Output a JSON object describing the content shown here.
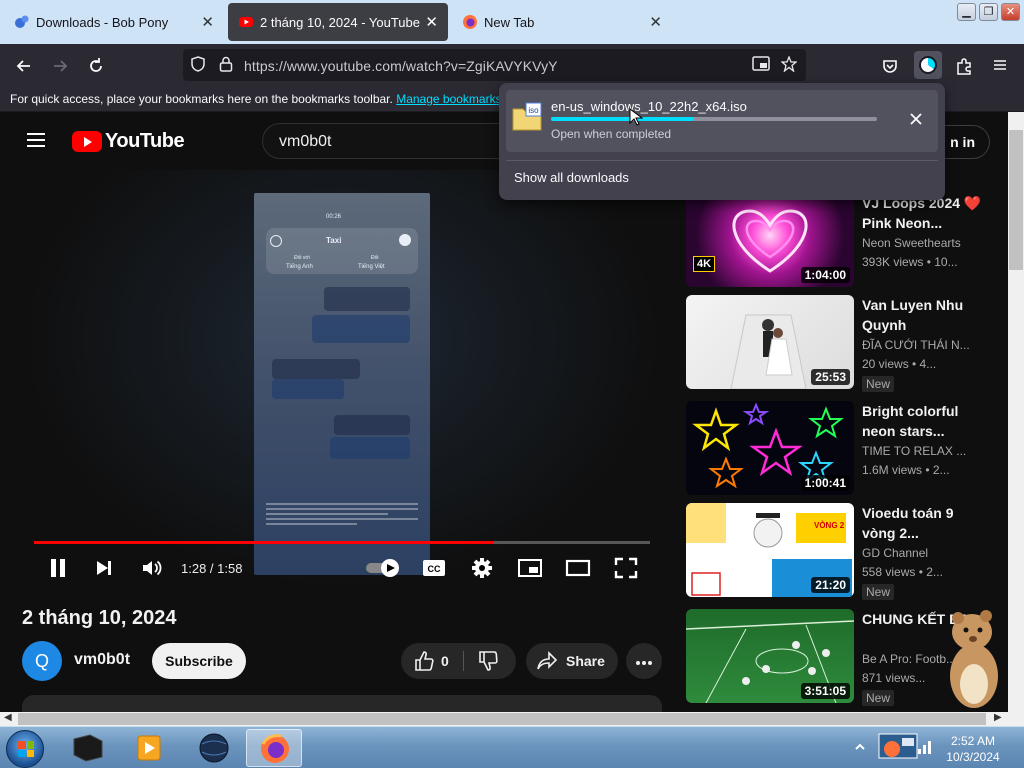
{
  "browser": {
    "tabs": [
      {
        "title": "Downloads - Bob Pony",
        "active": false
      },
      {
        "title": "2 tháng 10, 2024 - YouTube",
        "active": true
      },
      {
        "title": "New Tab",
        "active": false
      }
    ],
    "url": "https://www.youtube.com/watch?v=ZgiKAVYKVyY",
    "bookmarks_hint": "For quick access, place your bookmarks here on the bookmarks toolbar.",
    "bookmarks_link": "Manage bookmarks..."
  },
  "downloads_panel": {
    "file_name": "en-us_windows_10_22h2_x64.iso",
    "file_type_label": "iso",
    "status": "Open when completed",
    "progress": 0.44,
    "show_all": "Show all downloads"
  },
  "youtube": {
    "logo_text": "YouTube",
    "search_value": "vm0b0t",
    "sign_in_label": "n in",
    "player": {
      "time": "1:28 / 1:58",
      "progress": 0.746
    },
    "video_title": "2 tháng 10, 2024",
    "channel": {
      "name": "vm0b0t",
      "avatar_letter": "Q"
    },
    "subscribe_label": "Subscribe",
    "like_count": "0",
    "share_label": "Share",
    "phone_screen": {
      "time": "00:26",
      "header": "Taxi",
      "from_label": "Đối với",
      "from_lang": "Tiếng Anh",
      "to_label": "Đối",
      "to_lang": "Tiếng Việt"
    },
    "recommendations": [
      {
        "title": "VJ Loops 2024 ❤️ Pink Neon...",
        "channel": "Neon Sweethearts",
        "meta": "393K views • 10...",
        "duration": "1:04:00",
        "badge": "",
        "thumb_badge": "4K"
      },
      {
        "title": "Van Luyen Nhu Quynh",
        "channel": "ĐĨA CƯỚI THÁI N...",
        "meta": "20 views • 4...",
        "duration": "25:53",
        "badge": "New",
        "thumb_badge": ""
      },
      {
        "title": "Bright colorful neon stars...",
        "channel": "TIME TO RELAX ...",
        "meta": "1.6M views • 2...",
        "duration": "1:00:41",
        "badge": "",
        "thumb_badge": ""
      },
      {
        "title": "Vioedu toán 9 vòng 2...",
        "channel": "GD Channel",
        "meta": "558 views • 2...",
        "duration": "21:20",
        "badge": "New",
        "thumb_badge": "VÒNG 2"
      },
      {
        "title": "CHUNG KẾT BAP...",
        "channel": "Be A Pro: Footb...",
        "meta": "871 views...",
        "duration": "3:51:05",
        "badge": "New",
        "thumb_badge": ""
      }
    ]
  },
  "taskbar": {
    "time": "2:52 AM",
    "date": "10/3/2024"
  },
  "colors": {
    "yt_red": "#ff0000",
    "firefox_accent": "#00ddff",
    "yt_bg": "#0f0f0f"
  }
}
